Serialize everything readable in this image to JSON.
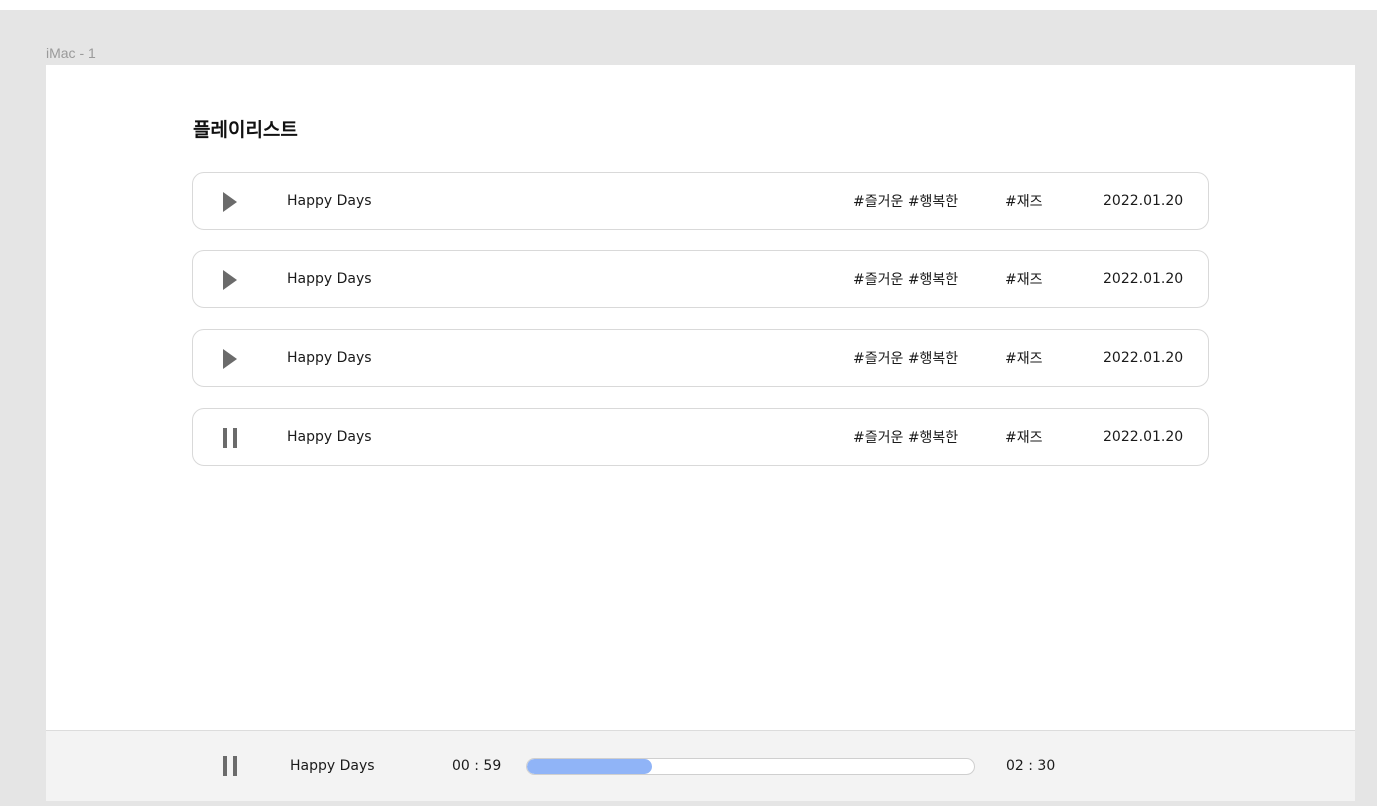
{
  "frame": {
    "label": "iMac - 1"
  },
  "page": {
    "title": "플레이리스트"
  },
  "tracks": [
    {
      "state": "play",
      "title": "Happy Days",
      "mood": "#즐거운 #행복한",
      "genre": "#재즈",
      "date": "2022.01.20"
    },
    {
      "state": "play",
      "title": "Happy Days",
      "mood": "#즐거운 #행복한",
      "genre": "#재즈",
      "date": "2022.01.20"
    },
    {
      "state": "play",
      "title": "Happy Days",
      "mood": "#즐거운 #행복한",
      "genre": "#재즈",
      "date": "2022.01.20"
    },
    {
      "state": "pause",
      "title": "Happy Days",
      "mood": "#즐거운 #행복한",
      "genre": "#재즈",
      "date": "2022.01.20"
    }
  ],
  "player": {
    "state": "pause",
    "title": "Happy Days",
    "elapsed": "00 : 59",
    "total": "02 : 30",
    "progress_fraction": 0.28
  },
  "colors": {
    "progress_fill": "#90b4f7",
    "icon": "#6b6b6b",
    "canvas_bg": "#e5e5e5"
  }
}
